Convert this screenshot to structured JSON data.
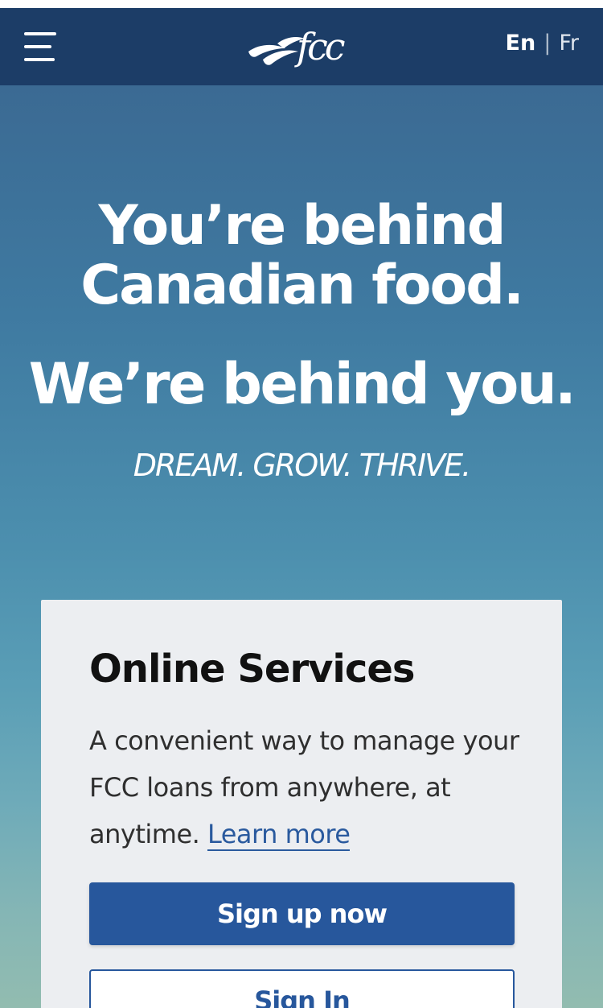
{
  "header": {
    "logo_text": "fcc",
    "lang_en": "En",
    "lang_separator": "|",
    "lang_fr": "Fr",
    "background_color": "#1c3d67"
  },
  "hero": {
    "headline_line1": "You’re behind",
    "headline_line2": "Canadian food.",
    "headline_line3": "We’re behind you.",
    "tagline": "DREAM. GROW. THRIVE."
  },
  "online_services": {
    "title": "Online Services",
    "description": "A convenient way to manage your FCC loans from anywhere, at anytime.",
    "learn_more_label": "Learn more",
    "signup_label": "Sign up now",
    "signin_label": "Sign In",
    "accent_color": "#27579c"
  }
}
